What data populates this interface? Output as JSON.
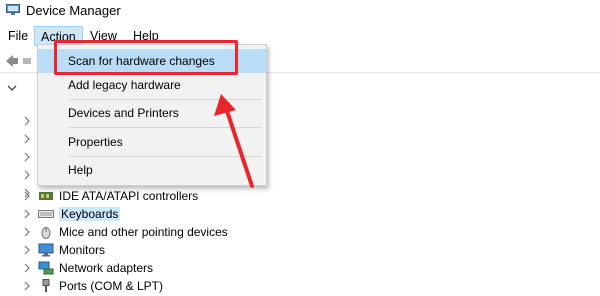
{
  "window": {
    "title": "Device Manager"
  },
  "menubar": {
    "items": [
      "File",
      "Action",
      "View",
      "Help"
    ]
  },
  "action_menu": {
    "items": [
      "Scan for hardware changes",
      "Add legacy hardware",
      "Devices and Printers",
      "Properties",
      "Help"
    ]
  },
  "tree": {
    "devices": [
      "IDE ATA/ATAPI controllers",
      "Keyboards",
      "Mice and other pointing devices",
      "Monitors",
      "Network adapters",
      "Ports (COM & LPT)"
    ]
  },
  "colors": {
    "accent": "#e8262b",
    "menu_highlight": "#b9dcf7",
    "selection": "#cce8ff"
  }
}
